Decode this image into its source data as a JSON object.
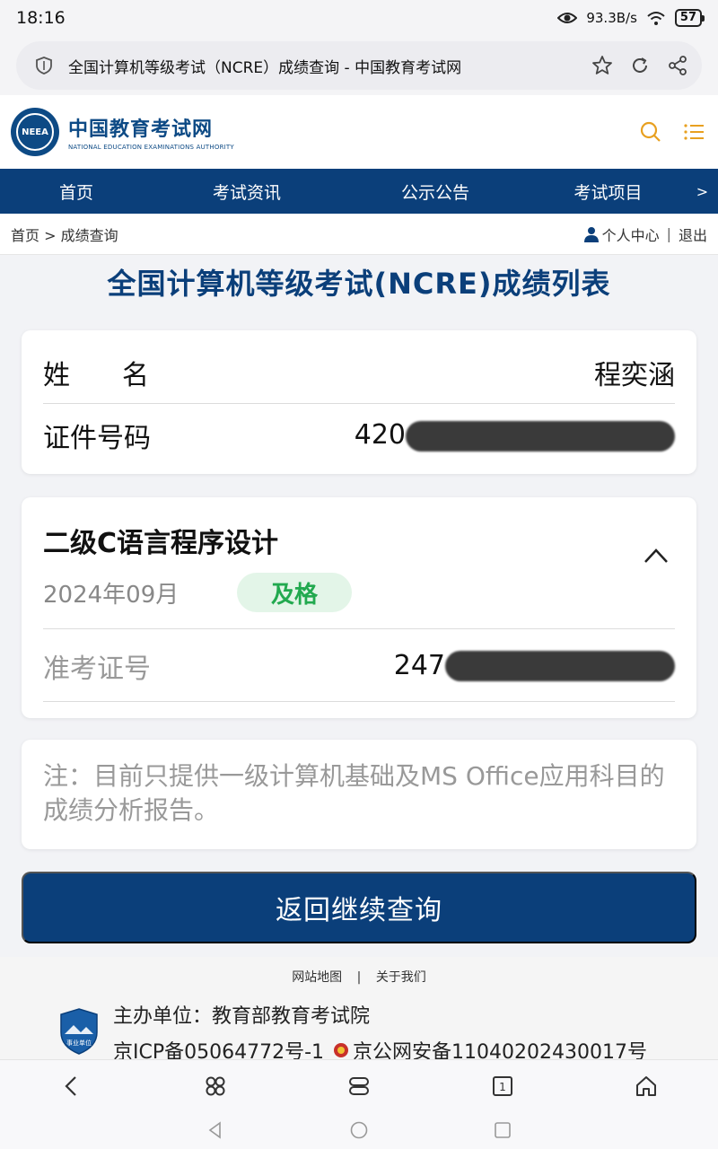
{
  "status_bar": {
    "time": "18:16",
    "net_speed": "93.3B/s",
    "battery": "57"
  },
  "browser": {
    "tab_title": "全国计算机等级考试（NCRE）成绩查询 - 中国教育考试网"
  },
  "site": {
    "logo_cn": "中国教育考试网",
    "logo_en": "NATIONAL EDUCATION EXAMINATIONS AUTHORITY",
    "logo_mark": "NEEA"
  },
  "nav": {
    "items": [
      {
        "label": "首页"
      },
      {
        "label": "考试资讯"
      },
      {
        "label": "公示公告"
      },
      {
        "label": "考试项目"
      }
    ],
    "more": ">"
  },
  "breadcrumb": {
    "home": "首页",
    "sep": ">",
    "current": "成绩查询"
  },
  "user_links": {
    "personal_center": "个人中心",
    "sep": "|",
    "logout": "退出"
  },
  "page": {
    "title": "全国计算机等级考试(NCRE)成绩列表"
  },
  "person": {
    "name_label": "姓名",
    "name_value": "程奕涵",
    "id_label": "证件号码",
    "id_prefix": "420"
  },
  "exam": {
    "subject": "二级C语言程序设计",
    "date": "2024年09月",
    "result": "及格",
    "ticket_label": "准考证号",
    "ticket_prefix": "247"
  },
  "note": {
    "text": "注：目前只提供一级计算机基础及MS Office应用科目的成绩分析报告。"
  },
  "actions": {
    "back_label": "返回继续查询"
  },
  "footer": {
    "sitemap": "网站地图",
    "sep": "|",
    "about": "关于我们",
    "host": "主办单位：教育部教育考试院",
    "icp": "京ICP备05064772号-1",
    "police": "京公网安备11040202430017号",
    "badge": "事业单位"
  },
  "colors": {
    "brand": "#0b3f7a",
    "pass_bg": "#e3f5e8",
    "pass_text": "#22a94f"
  }
}
